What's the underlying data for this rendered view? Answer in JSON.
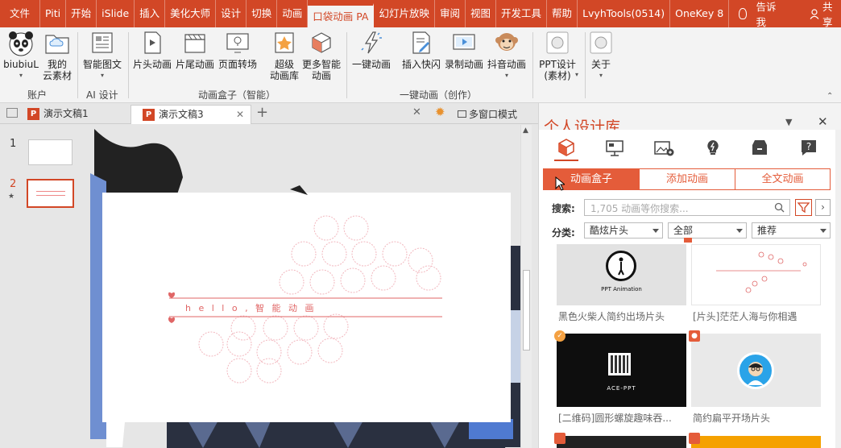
{
  "tabs": [
    "文件",
    "Piti",
    "开始",
    "iSlide",
    "插入",
    "美化大师",
    "设计",
    "切换",
    "动画",
    "口袋动画 PA",
    "幻灯片放映",
    "审阅",
    "视图",
    "开发工具",
    "帮助",
    "LvyhTools(0514)",
    "OneKey 8"
  ],
  "tell_me": "告诉我",
  "share": "共享",
  "ribbon": {
    "account": {
      "btn1": "biubiuL",
      "btn2a": "我的",
      "btn2b": "云素材",
      "label": "账户"
    },
    "ai": {
      "btn1": "智能图文",
      "label": "AI 设计"
    },
    "box": {
      "b1": "片头动画",
      "b2": "片尾动画",
      "b3": "页面转场",
      "b4a": "超级",
      "b4b": "动画库",
      "b5a": "更多智能",
      "b5b": "动画",
      "label": "动画盒子（智能）"
    },
    "create": {
      "b1": "一键动画",
      "b2": "插入快闪",
      "b3": "录制动画",
      "b4": "抖音动画",
      "label": "一键动画（创作）"
    },
    "ppt": {
      "b1a": "PPT设计",
      "b1b": "(素材)",
      "b2": "关于"
    }
  },
  "doctabs": {
    "t1": "演示文稿1",
    "t2": "演示文稿3",
    "multi": "多窗口模式"
  },
  "slides": {
    "n1": "1",
    "n2": "2",
    "star": "★"
  },
  "slide_text": "h  e  l  l  o  ,   智  能  动  画",
  "pane": {
    "title": "个人设计库",
    "tabs": [
      "动画盒子",
      "添加动画",
      "全文动画"
    ],
    "search_label": "搜索:",
    "search_placeholder": "1,705 动画等你搜索...",
    "cat_label": "分类:",
    "cat1": "酷炫片头",
    "cat2": "全部",
    "cat3": "推荐",
    "cards": [
      {
        "caption": "黑色火柴人简约出场片头",
        "thumb_text": "PPT Animation"
      },
      {
        "caption": "[片头]茫茫人海与你相遇",
        "thumb_text": ""
      },
      {
        "caption": "[二维码]圆形螺旋趣味吞...",
        "thumb_text": "ACE-PPT"
      },
      {
        "caption": "简约扁平开场片头",
        "thumb_text": ""
      }
    ]
  },
  "colors": {
    "accent": "#d24726",
    "pane_accent": "#e45c3a"
  }
}
